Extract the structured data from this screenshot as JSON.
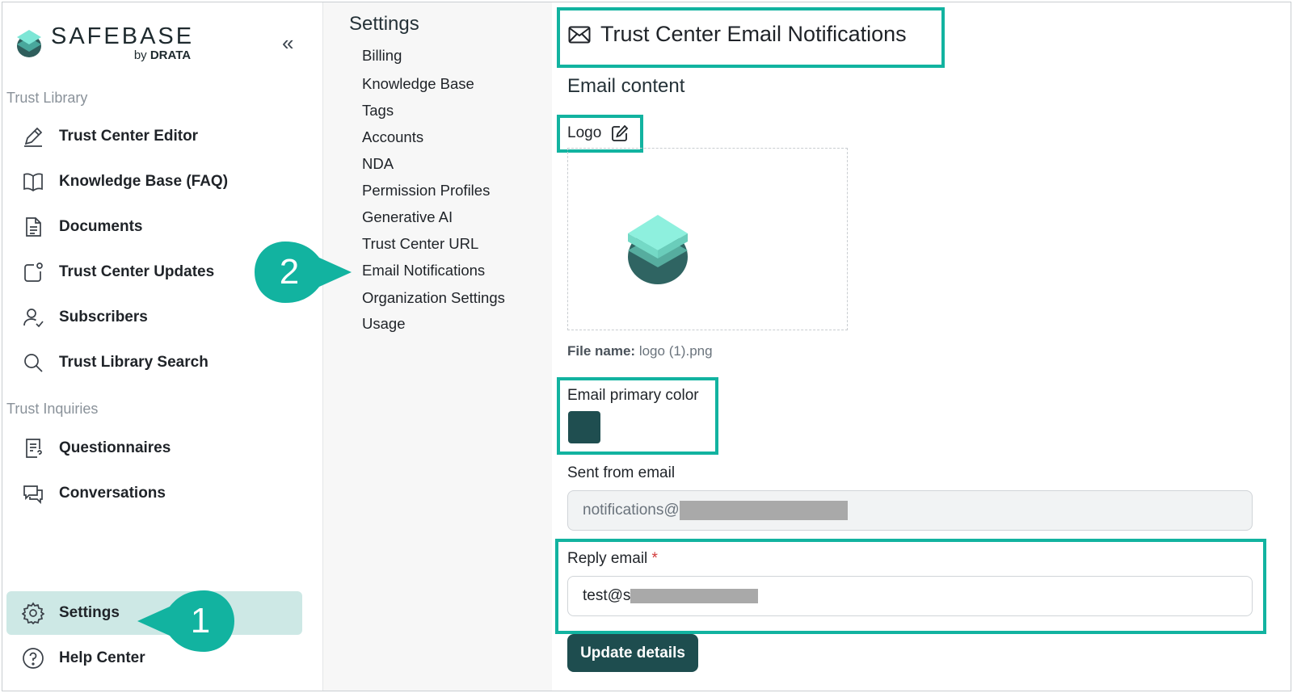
{
  "brand": {
    "name": "SAFEBASE",
    "by": "by",
    "company": "DRATA"
  },
  "sidebar": {
    "trust_library_label": "Trust Library",
    "trust_inquiries_label": "Trust Inquiries",
    "items": [
      {
        "label": "Trust Center Editor",
        "icon": "pencil-icon"
      },
      {
        "label": "Knowledge Base (FAQ)",
        "icon": "book-icon"
      },
      {
        "label": "Documents",
        "icon": "document-icon"
      },
      {
        "label": "Trust Center Updates",
        "icon": "updates-icon"
      },
      {
        "label": "Subscribers",
        "icon": "user-check-icon"
      },
      {
        "label": "Trust Library Search",
        "icon": "search-icon"
      },
      {
        "label": "Questionnaires",
        "icon": "questionnaire-icon"
      },
      {
        "label": "Conversations",
        "icon": "chat-icon"
      },
      {
        "label": "Settings",
        "icon": "gear-icon"
      },
      {
        "label": "Help Center",
        "icon": "help-icon"
      }
    ]
  },
  "callouts": {
    "one": "1",
    "two": "2",
    "color": "#12b3a0"
  },
  "submenu": {
    "title": "Settings",
    "items": [
      "Billing",
      "Knowledge Base",
      "Tags",
      "Accounts",
      "NDA",
      "Permission Profiles",
      "Generative AI",
      "Trust Center URL",
      "Email Notifications",
      "Organization Settings",
      "Usage"
    ]
  },
  "main": {
    "title": "Trust Center Email Notifications",
    "section_title": "Email content",
    "logo_label": "Logo",
    "file_name_label": "File name:",
    "file_name_value": "logo (1).png",
    "color_label": "Email primary color",
    "primary_color": "#1f4e50",
    "sent_from_label": "Sent from email",
    "sent_from_value": "notifications@",
    "reply_label": "Reply email",
    "reply_required": "*",
    "reply_value": "test@s",
    "update_button": "Update details"
  },
  "colors": {
    "accent": "#12b3a0",
    "active_bg": "#cde8e5",
    "button": "#1e4d4f"
  }
}
